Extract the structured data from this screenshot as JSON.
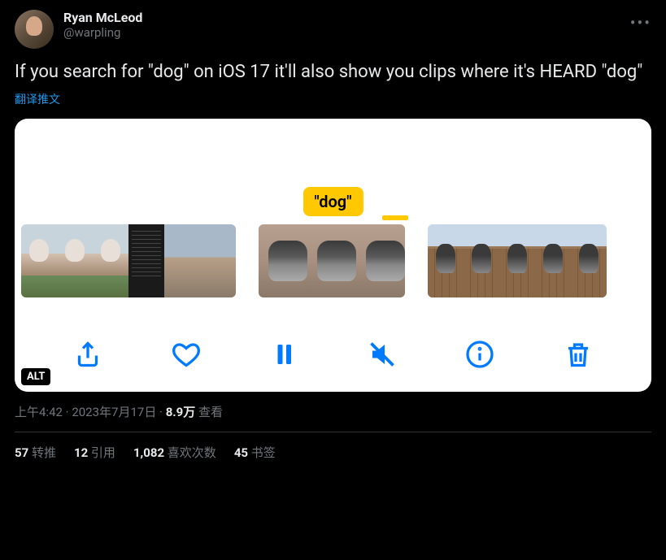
{
  "author": {
    "name": "Ryan McLeod",
    "handle": "@warpling"
  },
  "tweet_text": "If you search for \"dog\" on iOS 17 it'll also show you clips where it's HEARD \"dog\"",
  "translate_label": "翻译推文",
  "media": {
    "label_text": "\"dog\"",
    "alt_badge": "ALT"
  },
  "meta": {
    "time": "上午4:42",
    "date": "2023年7月17日",
    "views_count": "8.9万",
    "views_label": "查看"
  },
  "stats": {
    "retweets_count": "57",
    "retweets_label": "转推",
    "quotes_count": "12",
    "quotes_label": "引用",
    "likes_count": "1,082",
    "likes_label": "喜欢次数",
    "bookmarks_count": "45",
    "bookmarks_label": "书签"
  }
}
